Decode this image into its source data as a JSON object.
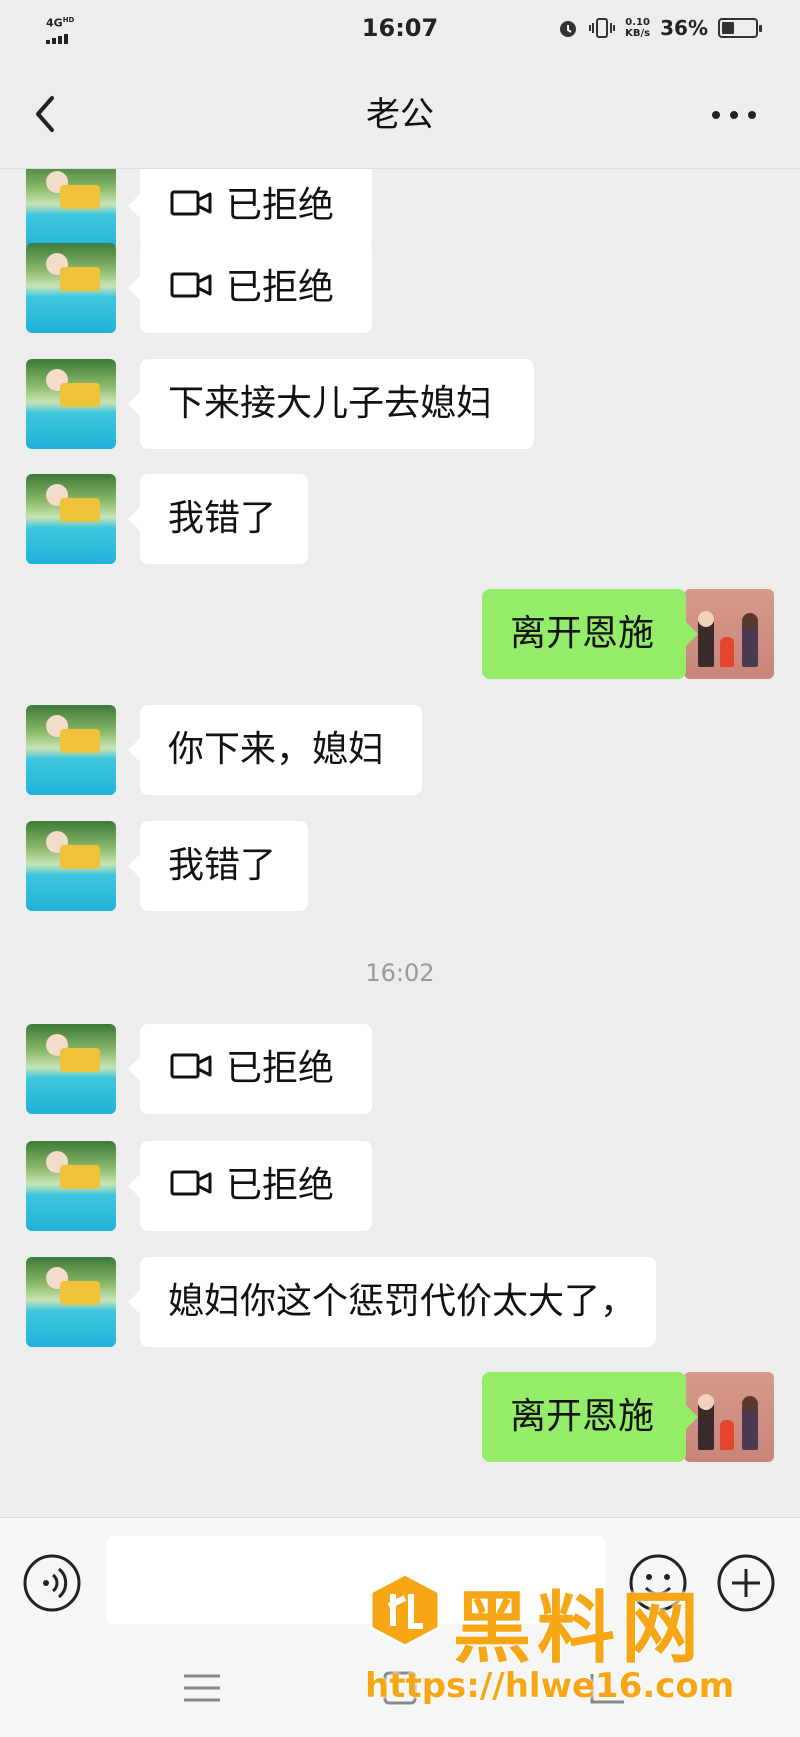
{
  "status_bar": {
    "network": "4G",
    "network_sup": "HD",
    "time": "16:07",
    "speed_value": "0.10",
    "speed_unit": "KB/s",
    "battery_text": "36%",
    "battery_level": 0.36
  },
  "header": {
    "title": "老公",
    "back_icon": "chevron-left-icon",
    "more_icon": "more-dots-icon"
  },
  "messages": [
    {
      "side": "in",
      "type": "video-call",
      "text": "已拒绝"
    },
    {
      "side": "in",
      "type": "video-call",
      "text": "已拒绝"
    },
    {
      "side": "in",
      "type": "text",
      "text": "下来接大儿子去媳妇"
    },
    {
      "side": "in",
      "type": "text",
      "text": "我错了"
    },
    {
      "side": "out",
      "type": "text",
      "text": "离开恩施"
    },
    {
      "side": "in",
      "type": "text",
      "text": "你下来，媳妇"
    },
    {
      "side": "in",
      "type": "text",
      "text": "我错了"
    },
    {
      "type": "timestamp",
      "text": "16:02"
    },
    {
      "side": "in",
      "type": "video-call",
      "text": "已拒绝"
    },
    {
      "side": "in",
      "type": "video-call",
      "text": "已拒绝"
    },
    {
      "side": "in",
      "type": "text",
      "text": "媳妇你这个惩罚代价太大了，"
    },
    {
      "side": "out",
      "type": "text",
      "text": "离开恩施"
    }
  ],
  "input_bar": {
    "voice_icon": "voice-icon",
    "emoji_icon": "emoji-icon",
    "plus_icon": "plus-icon",
    "input_value": ""
  },
  "watermark": {
    "title": "黑料网",
    "url": "https://hlwe16.com"
  },
  "colors": {
    "background": "#ededed",
    "incoming_bubble": "#ffffff",
    "outgoing_bubble": "#95ec69",
    "watermark": "#f7a716"
  }
}
